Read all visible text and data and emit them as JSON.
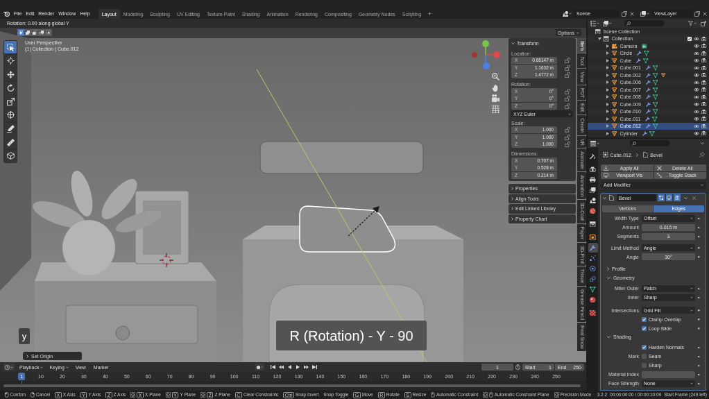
{
  "top_bar": {
    "menus": [
      "File",
      "Edit",
      "Render",
      "Window",
      "Help"
    ],
    "workspaces": [
      {
        "label": "Layout",
        "selected": true
      },
      {
        "label": "Modeling",
        "selected": false
      },
      {
        "label": "Sculpting",
        "selected": false
      },
      {
        "label": "UV Editing",
        "selected": false
      },
      {
        "label": "Texture Paint",
        "selected": false
      },
      {
        "label": "Shading",
        "selected": false
      },
      {
        "label": "Animation",
        "selected": false
      },
      {
        "label": "Rendering",
        "selected": false
      },
      {
        "label": "Compositing",
        "selected": false
      },
      {
        "label": "Geometry Nodes",
        "selected": false
      },
      {
        "label": "Scripting",
        "selected": false
      }
    ],
    "add_workspace": "+",
    "scene": "Scene",
    "view_layer": "ViewLayer"
  },
  "viewport": {
    "header_text": "Rotation: 0.00 along global Y",
    "select_modes": [
      {
        "kind": "set",
        "selected": true
      },
      {
        "kind": "extend",
        "selected": false
      },
      {
        "kind": "subtract",
        "selected": false
      },
      {
        "kind": "invert",
        "selected": false
      },
      {
        "kind": "intersect",
        "selected": false
      }
    ],
    "options": "Options",
    "view_name": "User Perspective",
    "view_info": "(1) Collection | Cube.012",
    "tools": [
      {
        "kind": "select_box",
        "selected": true
      },
      {
        "kind": "cursor",
        "selected": false
      },
      {
        "kind": "move",
        "selected": false
      },
      {
        "kind": "rotate",
        "selected": false
      },
      {
        "kind": "scale",
        "selected": false
      },
      {
        "kind": "transform",
        "selected": false
      },
      {
        "kind": "annotate",
        "selected": false
      },
      {
        "kind": "measure",
        "selected": false
      },
      {
        "kind": "add_cube",
        "selected": false
      }
    ],
    "key_display": "y",
    "caption": "R (Rotation) - Y - 90",
    "last_operator": {
      "label": "Set Origin",
      "expanded": false
    }
  },
  "sidebar": {
    "tabs": [
      {
        "label": "Item",
        "selected": true
      },
      {
        "label": "Tool",
        "selected": false
      },
      {
        "label": "View",
        "selected": false
      },
      {
        "label": "PDT",
        "selected": false
      },
      {
        "label": "Edit",
        "selected": false
      },
      {
        "label": "Create",
        "selected": false
      },
      {
        "label": "VR",
        "selected": false
      },
      {
        "label": "Animate",
        "selected": false
      },
      {
        "label": "Animation",
        "selected": false
      },
      {
        "label": "3D-Coat",
        "selected": false
      },
      {
        "label": "Paper",
        "selected": false
      },
      {
        "label": "3D-Print",
        "selected": false
      },
      {
        "label": "Tissue",
        "selected": false
      },
      {
        "label": "Grease Pencil",
        "selected": false
      },
      {
        "label": "Real Snow",
        "selected": false
      }
    ],
    "transform": {
      "title": "Transform",
      "expanded": true,
      "groups": [
        {
          "label": "Location:",
          "lockable": true,
          "fields": [
            {
              "axis": "X",
              "value": "0.66147 m"
            },
            {
              "axis": "Y",
              "value": "1.1632 m"
            },
            {
              "axis": "Z",
              "value": "1.4772 m"
            }
          ]
        },
        {
          "label": "Rotation:",
          "lockable": true,
          "fields": [
            {
              "axis": "X",
              "value": "0°"
            },
            {
              "axis": "Y",
              "value": "0°"
            },
            {
              "axis": "Z",
              "value": "0°"
            }
          ],
          "mode": "XYZ Euler"
        },
        {
          "label": "Scale:",
          "lockable": true,
          "fields": [
            {
              "axis": "X",
              "value": "1.000"
            },
            {
              "axis": "Y",
              "value": "1.000"
            },
            {
              "axis": "Z",
              "value": "1.000"
            }
          ]
        },
        {
          "label": "Dimensions:",
          "lockable": false,
          "fields": [
            {
              "axis": "X",
              "value": "0.707 m"
            },
            {
              "axis": "Y",
              "value": "0.528 m"
            },
            {
              "axis": "Z",
              "value": "0.214 m"
            }
          ]
        }
      ]
    },
    "panels": [
      {
        "title": "Properties",
        "expanded": false
      },
      {
        "title": "Align Tools",
        "expanded": false
      },
      {
        "title": "Edit Linked Library",
        "expanded": false
      },
      {
        "title": "Property Chart",
        "expanded": false
      }
    ]
  },
  "outliner": {
    "tree": [
      {
        "label": "Scene Collection",
        "kind": "scene_collection",
        "selected": false,
        "children": [
          {
            "label": "Collection",
            "kind": "collection",
            "expanded": true,
            "included": true,
            "selected": false,
            "children": [
              {
                "label": "Camera",
                "kind": "camera",
                "expanded": false,
                "modifiers": false,
                "child_objects": false,
                "selected": false
              },
              {
                "label": "Circle",
                "kind": "mesh",
                "expanded": false,
                "modifiers": true,
                "child_objects": false,
                "selected": false
              },
              {
                "label": "Cube",
                "kind": "mesh",
                "expanded": false,
                "modifiers": true,
                "child_objects": false,
                "selected": false
              },
              {
                "label": "Cube.001",
                "kind": "mesh",
                "expanded": false,
                "modifiers": true,
                "child_objects": false,
                "selected": false
              },
              {
                "label": "Cube.002",
                "kind": "mesh",
                "expanded": false,
                "modifiers": true,
                "child_objects": true,
                "selected": false
              },
              {
                "label": "Cube.006",
                "kind": "mesh",
                "expanded": false,
                "modifiers": true,
                "child_objects": false,
                "selected": false
              },
              {
                "label": "Cube.007",
                "kind": "mesh",
                "expanded": false,
                "modifiers": true,
                "child_objects": false,
                "selected": false
              },
              {
                "label": "Cube.008",
                "kind": "mesh",
                "expanded": false,
                "modifiers": true,
                "child_objects": false,
                "selected": false
              },
              {
                "label": "Cube.009",
                "kind": "mesh",
                "expanded": false,
                "modifiers": true,
                "child_objects": false,
                "selected": false
              },
              {
                "label": "Cube.010",
                "kind": "mesh",
                "expanded": false,
                "modifiers": true,
                "child_objects": false,
                "selected": false
              },
              {
                "label": "Cube.011",
                "kind": "mesh",
                "expanded": false,
                "modifiers": true,
                "child_objects": false,
                "selected": false
              },
              {
                "label": "Cube.012",
                "kind": "mesh",
                "expanded": false,
                "modifiers": true,
                "child_objects": false,
                "selected": true
              },
              {
                "label": "Cylinder",
                "kind": "mesh",
                "expanded": false,
                "modifiers": true,
                "child_objects": false,
                "selected": false
              }
            ]
          }
        ]
      }
    ]
  },
  "properties": {
    "tab_groups": [
      [
        {
          "kind": "tool",
          "selected": false
        }
      ],
      [
        {
          "kind": "render",
          "selected": false
        },
        {
          "kind": "output",
          "selected": false
        },
        {
          "kind": "view_layer",
          "selected": false
        },
        {
          "kind": "scene",
          "selected": false
        },
        {
          "kind": "world",
          "selected": false
        }
      ],
      [
        {
          "kind": "collection",
          "selected": false
        }
      ],
      [
        {
          "kind": "object",
          "selected": false
        },
        {
          "kind": "modifiers",
          "selected": true
        },
        {
          "kind": "particles",
          "selected": false
        },
        {
          "kind": "physics",
          "selected": false
        },
        {
          "kind": "constraints",
          "selected": false
        },
        {
          "kind": "data",
          "selected": false
        },
        {
          "kind": "material",
          "selected": false
        }
      ],
      [
        {
          "kind": "texture",
          "selected": false
        }
      ]
    ],
    "breadcrumb": [
      {
        "kind": "object",
        "label": "Cube.012"
      },
      {
        "kind": "modifier",
        "label": "Bevel"
      }
    ],
    "actions": [
      {
        "kind": "apply",
        "label": "Apply All"
      },
      {
        "kind": "delete",
        "label": "Delete All"
      },
      {
        "kind": "viewport",
        "label": "Viewport Vis"
      },
      {
        "kind": "stack",
        "label": "Toggle Stack"
      }
    ],
    "add_modifier": "Add Modifier",
    "modifier": {
      "name": "Bevel",
      "expanded": true,
      "edit_mode": true,
      "viewport": true,
      "render": true,
      "tabs": [
        {
          "label": "Vertices",
          "selected": false
        },
        {
          "label": "Edges",
          "selected": true
        }
      ],
      "groups": [
        [
          {
            "kind": "dropdown",
            "label": "Width Type",
            "value": "Offset"
          },
          {
            "kind": "number",
            "label": "Amount",
            "value": "0.015 m"
          },
          {
            "kind": "number",
            "label": "Segments",
            "value": "3"
          }
        ],
        [
          {
            "kind": "dropdown",
            "label": "Limit Method",
            "value": "Angle"
          },
          {
            "kind": "number",
            "label": "Angle",
            "value": "30°"
          }
        ]
      ],
      "subpanels": [
        {
          "title": "Profile",
          "expanded": false
        },
        {
          "title": "Geometry",
          "expanded": true,
          "groups": [
            [
              {
                "kind": "dropdown",
                "label": "Miter Outer",
                "value": "Patch"
              },
              {
                "kind": "dropdown",
                "label": "Inner",
                "value": "Sharp"
              }
            ],
            [
              {
                "kind": "dropdown",
                "label": "Intersections",
                "value": "Grid Fill"
              },
              {
                "kind": "checkbox",
                "text": "Clamp Overlap",
                "checked": true
              },
              {
                "kind": "checkbox",
                "text": "Loop Slide",
                "checked": true
              }
            ]
          ]
        },
        {
          "title": "Shading",
          "expanded": true,
          "groups": [
            [
              {
                "kind": "checkbox",
                "text": "Harden Normals",
                "checked": true
              },
              {
                "kind": "checkbox",
                "label": "Mark",
                "text": "Seam",
                "checked": false
              },
              {
                "kind": "checkbox",
                "text": "Sharp",
                "checked": false
              },
              {
                "kind": "number",
                "label": "Material Index"
              },
              {
                "kind": "dropdown",
                "label": "Face Strength",
                "value": "None"
              }
            ]
          ]
        }
      ]
    }
  },
  "timeline": {
    "menus": [
      {
        "label": "Playback",
        "kind": "dropdown"
      },
      {
        "label": "Keying",
        "kind": "dropdown"
      },
      {
        "label": "View",
        "kind": "menu"
      },
      {
        "label": "Marker",
        "kind": "menu"
      }
    ],
    "current_frame": "1",
    "start": {
      "label": "Start",
      "value": "1"
    },
    "end": {
      "label": "End",
      "value": "250"
    },
    "playhead": "1",
    "frame_labels": [
      "10",
      "20",
      "30",
      "40",
      "50",
      "60",
      "70",
      "80",
      "90",
      "100",
      "110",
      "120",
      "130",
      "140",
      "150",
      "160",
      "170",
      "180",
      "190",
      "200",
      "210",
      "220",
      "230",
      "240",
      "250"
    ]
  },
  "status_bar": {
    "hints": [
      {
        "keys": [
          {
            "kind": "mouse_left"
          }
        ],
        "label": "Confirm"
      },
      {
        "keys": [
          {
            "kind": "mouse_right"
          }
        ],
        "label": "Cancel"
      },
      {
        "keys": [
          {
            "kind": "key",
            "text": "X"
          }
        ],
        "label": "X Axis"
      },
      {
        "keys": [
          {
            "kind": "key",
            "text": "Y"
          }
        ],
        "label": "Y Axis"
      },
      {
        "keys": [
          {
            "kind": "key",
            "text": "Z"
          }
        ],
        "label": "Z Axis"
      },
      {
        "keys": [
          {
            "kind": "shift"
          },
          {
            "kind": "key",
            "text": "X"
          }
        ],
        "label": "X Plane"
      },
      {
        "keys": [
          {
            "kind": "shift"
          },
          {
            "kind": "key",
            "text": "Y"
          }
        ],
        "label": "Y Plane"
      },
      {
        "keys": [
          {
            "kind": "shift"
          },
          {
            "kind": "key",
            "text": "Z"
          }
        ],
        "label": "Z Plane"
      },
      {
        "keys": [
          {
            "kind": "key",
            "text": "C"
          }
        ],
        "label": "Clear Constraints"
      },
      {
        "keys": [
          {
            "kind": "key",
            "text": "Ctrl"
          }
        ],
        "label": "Snap Invert"
      },
      {
        "label": "Snap Toggle"
      },
      {
        "keys": [
          {
            "kind": "key",
            "text": "G"
          }
        ],
        "label": "Move"
      },
      {
        "keys": [
          {
            "kind": "key",
            "text": "R"
          }
        ],
        "label": "Rotate"
      },
      {
        "keys": [
          {
            "kind": "key",
            "text": "S"
          }
        ],
        "label": "Resize"
      },
      {
        "keys": [
          {
            "kind": "mouse_middle"
          }
        ],
        "label": "Automatic Constraint"
      },
      {
        "keys": [
          {
            "kind": "shift"
          },
          {
            "kind": "mouse_middle"
          }
        ],
        "label": "Automatic Constraint Plane"
      },
      {
        "keys": [
          {
            "kind": "shift"
          }
        ],
        "label": "Precision Mode"
      }
    ],
    "version": "3.2.2",
    "time": "00:00:00:00 / 00:00:10:09",
    "frame_info": "Start Frame (249 left)"
  }
}
